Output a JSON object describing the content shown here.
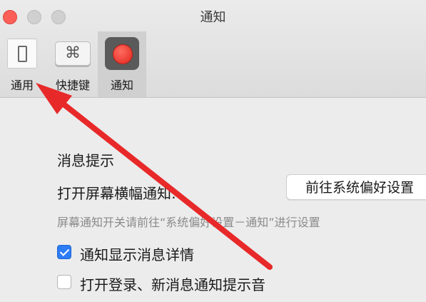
{
  "window": {
    "title": "通知"
  },
  "toolbar": {
    "items": [
      {
        "label": "通用",
        "icon": "phone-icon"
      },
      {
        "label": "快捷键",
        "icon": "command-key-icon",
        "glyph": "⌘"
      },
      {
        "label": "通知",
        "icon": "record-icon"
      }
    ],
    "selected": "通知"
  },
  "notifications": {
    "section_title": "消息提示",
    "banner_label": "打开屏幕横幅通知:",
    "banner_button": "前往系统偏好设置",
    "hint": "屏幕通知开关请前往“系统偏好设置－通知”进行设置",
    "options": [
      {
        "label": "通知显示消息详情",
        "checked": true
      },
      {
        "label": "打开登录、新消息通知提示音",
        "checked": false
      }
    ]
  },
  "colors": {
    "accent": "#2c7cf6",
    "annotation_arrow": "#e8292a",
    "close_button": "#fc5f57"
  }
}
